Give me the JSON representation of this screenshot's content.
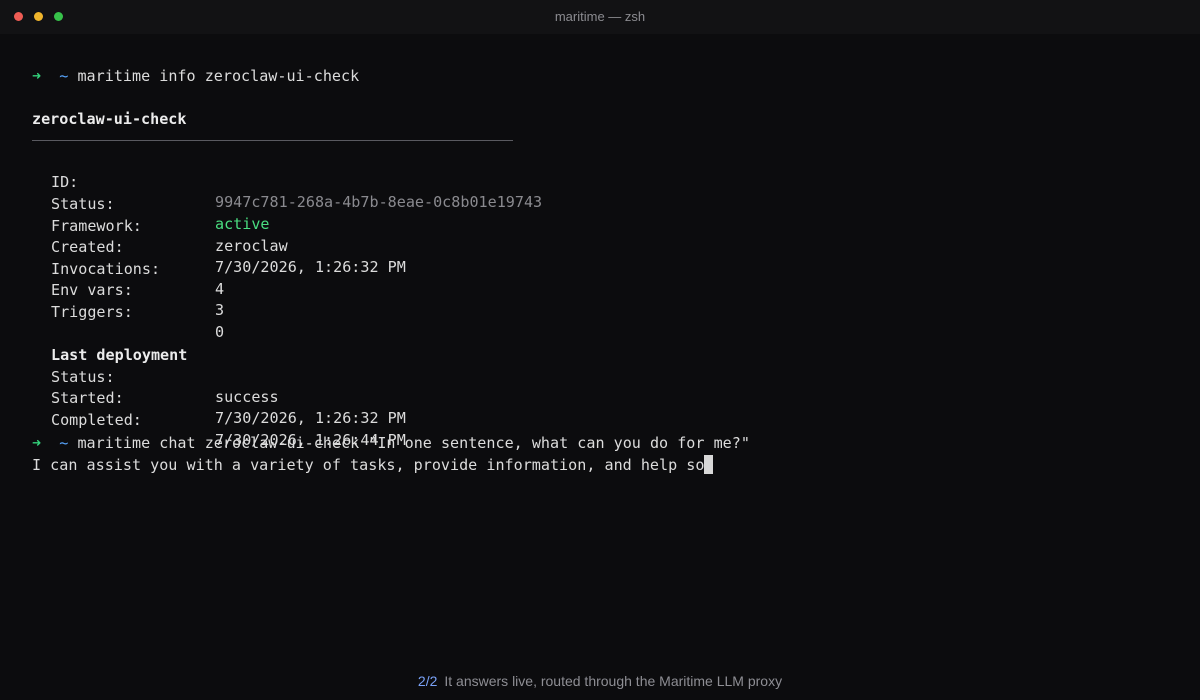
{
  "window": {
    "title": "maritime — zsh"
  },
  "prompt": {
    "arrow": "➜",
    "dir": "~"
  },
  "commands": {
    "info": "maritime info zeroclaw-ui-check",
    "chat": "maritime chat zeroclaw-ui-check \"In one sentence, what can you do for me?\""
  },
  "agent": {
    "name": "zeroclaw-ui-check",
    "fields": [
      {
        "label": "ID:",
        "value": "9947c781-268a-4b7b-8eae-0c8b01e19743"
      },
      {
        "label": "Status:",
        "value": "active"
      },
      {
        "label": "Framework:",
        "value": "zeroclaw"
      },
      {
        "label": "Created:",
        "value": "7/30/2026, 1:26:32 PM"
      },
      {
        "label": "Invocations:",
        "value": "4"
      },
      {
        "label": "Env vars:",
        "value": "3"
      },
      {
        "label": "Triggers:",
        "value": "0"
      }
    ]
  },
  "last_deployment": {
    "heading": "Last deployment",
    "fields": [
      {
        "label": "Status:",
        "value": "success"
      },
      {
        "label": "Started:",
        "value": "7/30/2026, 1:26:32 PM"
      },
      {
        "label": "Completed:",
        "value": "7/30/2026, 1:26:44 PM"
      }
    ]
  },
  "response": {
    "text": "I can assist you with a variety of tasks, provide information, and help so"
  },
  "footer": {
    "step": "2/2",
    "caption": "It answers live, routed through the Maritime LLM proxy"
  },
  "colors": {
    "background": "#0c0c0e",
    "prompt_arrow": "#33d17a",
    "prompt_dir": "#58a6ff",
    "status_active": "#4ade80",
    "footer_step": "#7aa2f7"
  }
}
